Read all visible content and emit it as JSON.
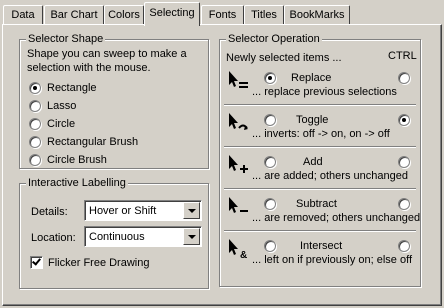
{
  "tabs": [
    "Data",
    "Bar Chart",
    "Colors",
    "Selecting",
    "Fonts",
    "Titles",
    "BookMarks"
  ],
  "active_tab": "Selecting",
  "selector_shape": {
    "legend": "Selector Shape",
    "description_line1": "Shape you can sweep to make a",
    "description_line2": "selection with the mouse.",
    "options": [
      "Rectangle",
      "Lasso",
      "Circle",
      "Rectangular Brush",
      "Circle Brush"
    ],
    "selected": "Rectangle"
  },
  "labelling": {
    "legend": "Interactive Labelling",
    "details_label": "Details:",
    "details_value": "Hover or Shift",
    "location_label": "Location:",
    "location_value": "Continuous",
    "flicker_label": "Flicker Free Drawing",
    "flicker_checked": true
  },
  "operation": {
    "legend": "Selector Operation",
    "header": "Newly selected items ...",
    "ctrl_label": "CTRL",
    "rows": [
      {
        "name": "Replace",
        "desc": "... replace previous selections",
        "icon": "cursor-replace-icon",
        "normal": true,
        "ctrl": false
      },
      {
        "name": "Toggle",
        "desc": "... inverts:  off -> on, on -> off",
        "icon": "cursor-toggle-icon",
        "normal": false,
        "ctrl": true
      },
      {
        "name": "Add",
        "desc": "... are added; others unchanged",
        "icon": "cursor-add-icon",
        "normal": false,
        "ctrl": false
      },
      {
        "name": "Subtract",
        "desc": "... are removed; others unchanged",
        "icon": "cursor-subtract-icon",
        "normal": false,
        "ctrl": false
      },
      {
        "name": "Intersect",
        "desc": "... left on if previously on; else off",
        "icon": "cursor-intersect-icon",
        "normal": false,
        "ctrl": false
      }
    ]
  }
}
